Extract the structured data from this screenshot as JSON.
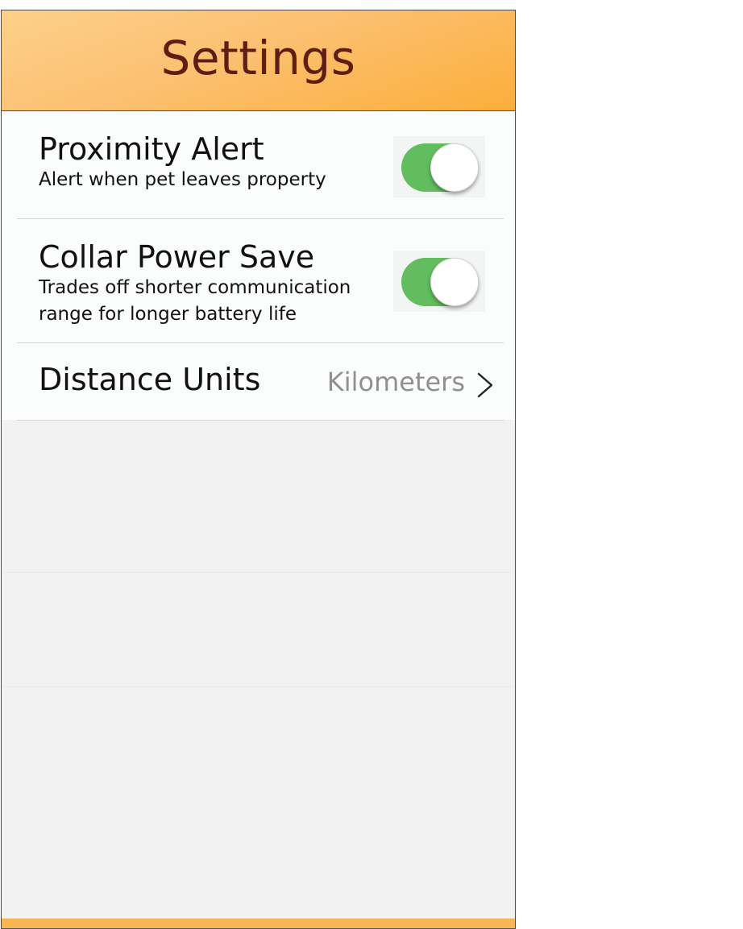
{
  "header": {
    "title": "Settings"
  },
  "settings": {
    "proximity": {
      "title": "Proximity Alert",
      "subtitle": "Alert when pet leaves property",
      "enabled": true
    },
    "power_save": {
      "title": "Collar Power Save",
      "subtitle": "Trades off shorter communication range for longer battery life",
      "enabled": true
    },
    "distance_units": {
      "title": "Distance Units",
      "value": "Kilometers"
    }
  },
  "colors": {
    "toggle_on": "#61bd5e",
    "header_text": "#5e1e14",
    "accent": "#f8b551"
  },
  "icons": {
    "disclosure": "chevron-right-icon"
  }
}
